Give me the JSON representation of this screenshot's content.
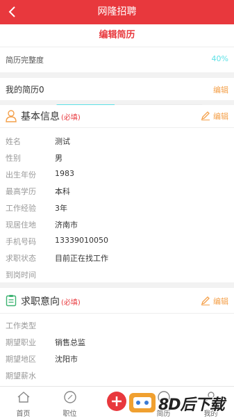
{
  "nav": {
    "title": "网隆招聘"
  },
  "edit_header": "编辑简历",
  "progress": {
    "label": "简历完整度",
    "value_text": "40%",
    "fraction": 0.4,
    "color": "#5ce1e6"
  },
  "resume_row": {
    "name": "我的简历0",
    "edit": "编辑"
  },
  "basic": {
    "title": "基本信息",
    "required": "(必填)",
    "edit": "编辑",
    "fields": [
      {
        "k": "姓名",
        "v": "测试"
      },
      {
        "k": "性别",
        "v": "男"
      },
      {
        "k": "出生年份",
        "v": "1983"
      },
      {
        "k": "最高学历",
        "v": "本科"
      },
      {
        "k": "工作经验",
        "v": "3年"
      },
      {
        "k": "现居住地",
        "v": "济南市"
      },
      {
        "k": "手机号码",
        "v": "13339010050"
      },
      {
        "k": "求职状态",
        "v": "目前正在找工作"
      },
      {
        "k": "到岗时间",
        "v": ""
      }
    ]
  },
  "intent": {
    "title": "求职意向",
    "required": "(必填)",
    "edit": "编辑",
    "fields": [
      {
        "k": "工作类型",
        "v": ""
      },
      {
        "k": "期望职业",
        "v": "销售总监"
      },
      {
        "k": "期望地区",
        "v": "沈阳市"
      },
      {
        "k": "期望薪水",
        "v": ""
      }
    ]
  },
  "tabs": [
    {
      "label": "首页",
      "icon": "home-icon"
    },
    {
      "label": "职位",
      "icon": "compass-icon"
    },
    {
      "label": "",
      "icon": "plus-icon"
    },
    {
      "label": "简历",
      "icon": "resume-icon"
    },
    {
      "label": "我的",
      "icon": "user-icon"
    }
  ],
  "watermark": "8D后下载",
  "colors": {
    "primary": "#e8383d",
    "accent": "#f4a04a",
    "progress": "#5ce1e6"
  }
}
